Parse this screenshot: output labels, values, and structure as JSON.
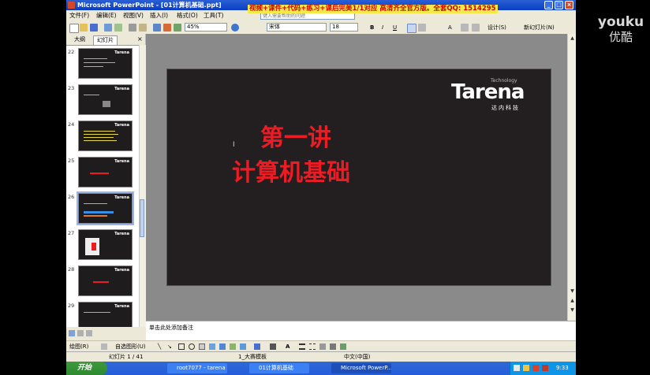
{
  "window": {
    "title": "Microsoft PowerPoint - [01计算机基础.ppt]"
  },
  "watermark": {
    "line1": "youku",
    "line2": "优酷"
  },
  "banner": {
    "text": "视频+课件+代码+练习+课后完美1/1对应 高清齐全官方版。全套QQ: 1514295"
  },
  "menubar": {
    "items": [
      "文件(F)",
      "编辑(E)",
      "视图(V)",
      "插入(I)",
      "格式(O)",
      "工具(T)"
    ],
    "help_placeholder": "键入需要帮助的问题"
  },
  "toolbar": {
    "zoom": "45%",
    "font_name": "宋体",
    "font_size": "18",
    "design_label": "设计(S)",
    "new_slide_label": "新幻灯片(N)"
  },
  "left_pane": {
    "tabs": [
      "大纲",
      "幻灯片"
    ],
    "thumbnails": [
      {
        "num": "22"
      },
      {
        "num": "23"
      },
      {
        "num": "24"
      },
      {
        "num": "25"
      },
      {
        "num": "26"
      },
      {
        "num": "27"
      },
      {
        "num": "28"
      },
      {
        "num": "29"
      }
    ]
  },
  "slide": {
    "logo": "Tarena",
    "logo_tech": "Technology",
    "logo_cn": "达内科技",
    "title_line1": "第一讲",
    "title_line2": "计算机基础"
  },
  "notes": {
    "placeholder": "单击此处添加备注"
  },
  "drawbar": {
    "draw_label": "绘图(R)",
    "autoshapes_label": "自选图形(U)"
  },
  "statusbar": {
    "slide_pos": "幻灯片 1 / 41",
    "design": "1_大赛模板",
    "language": "中文(中国)"
  },
  "taskbar": {
    "start_label": "开始",
    "tasks": [
      "root7077 - tarena",
      "01计算机基础",
      "Microsoft PowerP..."
    ],
    "clock": "9:33"
  },
  "colors": {
    "slide_bg": "#231f20",
    "title_red": "#ed1c24",
    "titlebar_blue": "#0a3ec2",
    "banner_yellow": "#f5e94a"
  }
}
